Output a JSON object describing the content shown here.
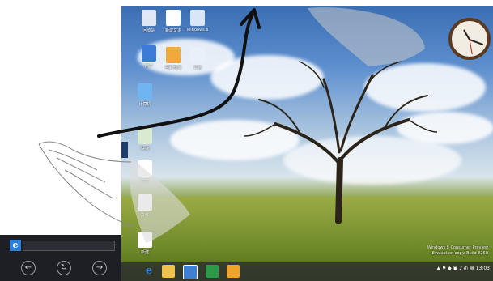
{
  "desktop": {
    "icons": [
      {
        "name": "recycle-bin",
        "label": "回收站",
        "color": "#dfe8f4"
      },
      {
        "name": "document",
        "label": "新建文本",
        "color": "#ffffff"
      },
      {
        "name": "network",
        "label": "Windows 8",
        "color": "#d8e6f6"
      },
      {
        "name": "user-folder",
        "label": "用户",
        "color": "#3b7bd6"
      },
      {
        "name": "control-panel",
        "label": "控制面板",
        "color": "#f2a93b"
      },
      {
        "name": "spreadsheet",
        "label": "文档",
        "color": "#e8f0fa"
      },
      {
        "name": "computer",
        "label": "计算机",
        "color": "#6fb6f0"
      },
      {
        "name": "shortcut",
        "label": "快捷",
        "color": "#d9ead3"
      },
      {
        "name": "file",
        "label": "文件",
        "color": "#ffffff"
      },
      {
        "name": "file-2",
        "label": "文件",
        "color": "#ffffff"
      },
      {
        "name": "file-3",
        "label": "新建",
        "color": "#ffffff"
      }
    ],
    "watermark_line1": "Windows 8 Consumer Preview",
    "watermark_line2": "Evaluation copy. Build 8250"
  },
  "taskbar": {
    "apps": [
      {
        "name": "ie",
        "color": "#2b7fd8",
        "label": "e"
      },
      {
        "name": "explorer",
        "color": "#f0c24a",
        "label": ""
      },
      {
        "name": "app-blue",
        "color": "#3f7fd6",
        "label": ""
      },
      {
        "name": "excel",
        "color": "#2e9a49",
        "label": ""
      },
      {
        "name": "outlook",
        "color": "#f0a32a",
        "label": ""
      }
    ],
    "tray_time": "13:03"
  },
  "charm": {
    "ie_label": "e",
    "back_glyph": "←",
    "refresh_glyph": "↻",
    "forward_glyph": "→"
  }
}
